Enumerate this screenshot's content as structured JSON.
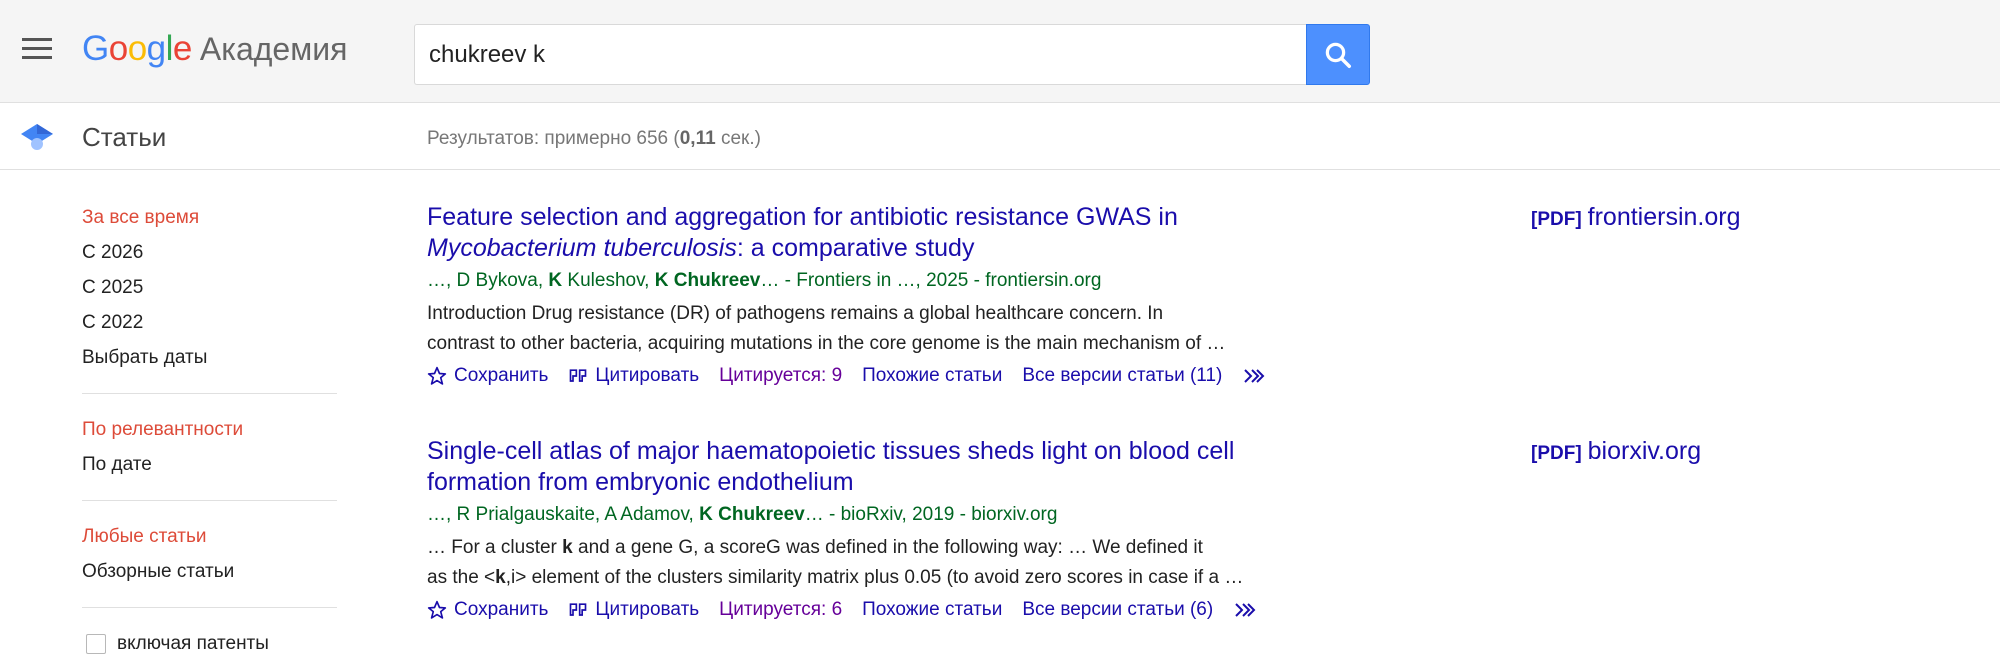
{
  "header": {
    "logo_letters": [
      "G",
      "o",
      "o",
      "g",
      "l",
      "e"
    ],
    "logo_suffix": "Академия",
    "search_value": "chukreev k"
  },
  "subheader": {
    "section_title": "Статьи",
    "results_prefix": "Результатов: примерно 656 (",
    "results_time": "0,11",
    "results_suffix": " сек.)"
  },
  "sidebar": {
    "time_filters": [
      "За все время",
      "С 2026",
      "С 2025",
      "С 2022",
      "Выбрать даты"
    ],
    "sort_options": [
      "По релевантности",
      "По дате"
    ],
    "type_options": [
      "Любые статьи",
      "Обзорные статьи"
    ],
    "include_patents": "включая патенты"
  },
  "results": [
    {
      "title_part1": "Feature selection and aggregation for antibiotic resistance GWAS in",
      "title_italic": "Mycobacterium tuberculosis",
      "title_part2": ": a comparative study",
      "authors_a": "…, D Bykova, ",
      "authors_b": "K",
      "authors_c": " Kuleshov, ",
      "authors_d": "K Chukreev",
      "authors_e": "… - Frontiers in …, 2025 - frontiersin.org",
      "snippet_line1": "Introduction Drug resistance (DR) of pathogens remains a global healthcare concern. In",
      "snippet_line2": "contrast to other bacteria, acquiring mutations in the core genome is the main mechanism of …",
      "save": "Сохранить",
      "cite": "Цитировать",
      "cited_by": "Цитируется: 9",
      "related": "Похожие статьи",
      "versions": "Все версии статьи (11)",
      "pdf_tag": "[PDF]",
      "pdf_source": "frontiersin.org"
    },
    {
      "title_part1": "Single-cell atlas of major haematopoietic tissues sheds light on blood cell",
      "title_part2": "formation from embryonic endothelium",
      "authors_a": "…, R Prialgauskaite, A Adamov, ",
      "authors_d": "K Chukreev",
      "authors_e": "… - bioRxiv, 2019 - biorxiv.org",
      "snippet_a": "… For a cluster ",
      "snippet_b": "k",
      "snippet_c": " and a gene G, a scoreG was defined in the following way: … We defined it",
      "snippet_d": "as the <",
      "snippet_e": "k",
      "snippet_f": ",i> element of the clusters similarity matrix plus 0.05 (to avoid zero scores in case if a …",
      "save": "Сохранить",
      "cite": "Цитировать",
      "cited_by": "Цитируется: 6",
      "related": "Похожие статьи",
      "versions": "Все версии статьи (6)",
      "pdf_tag": "[PDF]",
      "pdf_source": "biorxiv.org"
    }
  ],
  "icons": {
    "menu": "menu-icon",
    "search": "search-icon",
    "cap": "graduation-cap-icon",
    "save": "star-icon",
    "cite": "quote-icon",
    "more": "double-chevron-icon"
  },
  "colors": {
    "link": "#1a0dab",
    "authors": "#006621",
    "active_filter": "#dd4b39",
    "cited_by": "#660099",
    "search_button": "#4d90fe"
  }
}
